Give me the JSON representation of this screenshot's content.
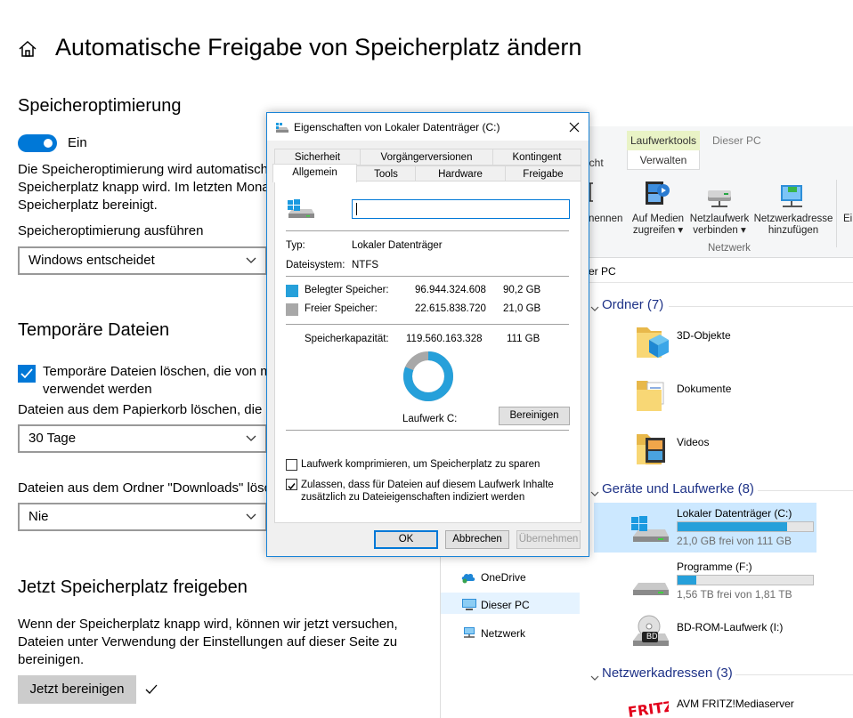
{
  "settings": {
    "title": "Automatische Freigabe von Speicherplatz ändern",
    "optimization": {
      "heading": "Speicheroptimierung",
      "toggle_label": "Ein",
      "description_lines": [
        "Die Speicheroptimierung wird automatisch",
        "Speicherplatz knapp wird. Im letzten Mona",
        "Speicherplatz bereinigt."
      ],
      "run_label": "Speicheroptimierung ausführen",
      "run_value": "Windows entscheidet"
    },
    "temp": {
      "heading": "Temporäre Dateien",
      "checkbox_lines": [
        "Temporäre Dateien löschen, die von m",
        "verwendet werden"
      ],
      "recycle_label": "Dateien aus dem Papierkorb löschen, die ä",
      "recycle_value": "30 Tage",
      "downloads_label": "Dateien aus dem Ordner \"Downloads\" lösc",
      "downloads_value": "Nie"
    },
    "free_now": {
      "heading": "Jetzt Speicherplatz freigeben",
      "description_lines": [
        "Wenn der Speicherplatz knapp wird, können wir jetzt versuchen,",
        "Dateien unter Verwendung der Einstellungen auf dieser Seite zu",
        "bereinigen."
      ],
      "button": "Jetzt bereinigen"
    }
  },
  "explorer": {
    "tabs": {
      "partial": "icht",
      "drive_tools": "Laufwerktools",
      "this_pc": "Dieser PC",
      "manage": "Verwalten"
    },
    "ribbon": {
      "partial": "nennen",
      "media": [
        "Auf Medien",
        "zugreifen ▾"
      ],
      "map_drive": [
        "Netzlaufwerk",
        "verbinden ▾"
      ],
      "net_location": [
        "Netzwerkadresse",
        "hinzufügen"
      ],
      "partial2": "Ei",
      "group_label": "Netzwerk"
    },
    "address": "er PC",
    "groups": {
      "folders": "Ordner (7)",
      "devices": "Geräte und Laufwerke (8)",
      "network": "Netzwerkadressen (3)"
    },
    "folders": [
      "3D-Objekte",
      "Dokumente",
      "Videos"
    ],
    "drives": [
      {
        "name": "Lokaler Datenträger (C:)",
        "free": "21,0 GB frei von 111 GB",
        "fill": 0.81
      },
      {
        "name": "Programme (F:)",
        "free": "1,56 TB frei von 1,81 TB",
        "fill": 0.14
      }
    ],
    "bdrom": "BD-ROM-Laufwerk (I:)",
    "bd_badge": "BD",
    "network_item": "AVM FRITZ!Mediaserver",
    "fritz_logo": "FRITZ!",
    "nav": [
      "OneDrive",
      "Dieser PC",
      "Netzwerk"
    ]
  },
  "dialog": {
    "title": "Eigenschaften von Lokaler Datenträger (C:)",
    "tabs_row1": [
      "Sicherheit",
      "Vorgängerversionen",
      "Kontingent"
    ],
    "tabs_row2": [
      "Allgemein",
      "Tools",
      "Hardware",
      "Freigabe"
    ],
    "name_value": "",
    "type_label": "Typ:",
    "type_value": "Lokaler Datenträger",
    "fs_label": "Dateisystem:",
    "fs_value": "NTFS",
    "used_label": "Belegter Speicher:",
    "used_bytes": "96.944.324.608",
    "used_gb": "90,2 GB",
    "free_label": "Freier Speicher:",
    "free_bytes": "22.615.838.720",
    "free_gb": "21,0 GB",
    "cap_label": "Speicherkapazität:",
    "cap_bytes": "119.560.163.328",
    "cap_gb": "111 GB",
    "used_fraction": 0.811,
    "drive_label": "Laufwerk C:",
    "cleanup_button": "Bereinigen",
    "compress_label": "Laufwerk komprimieren, um Speicherplatz zu sparen",
    "index_lines": [
      "Zulassen, dass für Dateien auf diesem Laufwerk Inhalte",
      "zusätzlich zu Dateieigenschaften indiziert werden"
    ],
    "ok": "OK",
    "cancel": "Abbrechen",
    "apply": "Übernehmen",
    "colors": {
      "used": "#26a0da",
      "free": "#a8a8a8",
      "accent": "#0078d7"
    }
  }
}
